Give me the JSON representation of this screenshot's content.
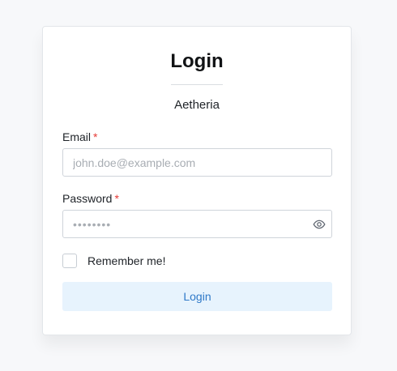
{
  "login": {
    "title": "Login",
    "brand": "Aetheria",
    "email": {
      "label": "Email",
      "required_mark": "*",
      "placeholder": "john.doe@example.com",
      "value": ""
    },
    "password": {
      "label": "Password",
      "required_mark": "*",
      "placeholder": "••••••••",
      "value": ""
    },
    "remember": {
      "label": "Remember me!",
      "checked": false
    },
    "submit_label": "Login"
  },
  "colors": {
    "accent": "#2f79c8",
    "button_background": "#e7f3fd",
    "required": "#e53935",
    "page_background": "#f7f8fa"
  },
  "icons": {
    "password_toggle": "eye-icon"
  }
}
